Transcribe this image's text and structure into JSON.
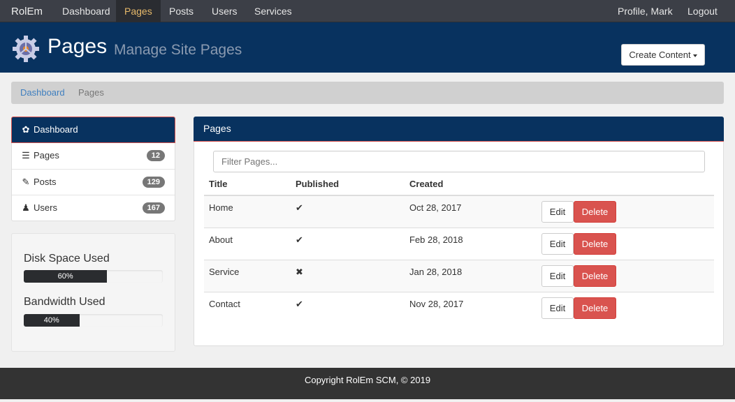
{
  "navbar": {
    "brand": "RolEm",
    "items": [
      {
        "label": "Dashboard",
        "active": false
      },
      {
        "label": "Pages",
        "active": true
      },
      {
        "label": "Posts",
        "active": false
      },
      {
        "label": "Users",
        "active": false
      },
      {
        "label": "Services",
        "active": false
      }
    ],
    "right": {
      "profile": "Profile, Mark",
      "logout": "Logout"
    }
  },
  "header": {
    "logo_icon": "gear-icon",
    "title": "Pages",
    "subtitle": "Manage Site Pages",
    "create_button": "Create Content"
  },
  "breadcrumb": {
    "link": "Dashboard",
    "current": "Pages"
  },
  "sidebar": {
    "items": [
      {
        "label": "Dashboard",
        "icon": "cog-icon",
        "active": true
      },
      {
        "label": "Pages",
        "icon": "list-icon",
        "count": "12"
      },
      {
        "label": "Posts",
        "icon": "pencil-icon",
        "count": "129"
      },
      {
        "label": "Users",
        "icon": "user-icon",
        "count": "167"
      }
    ]
  },
  "usage": {
    "disk": {
      "label": "Disk Space Used",
      "percent": 60,
      "text": "60%"
    },
    "bandwidth": {
      "label": "Bandwidth Used",
      "percent": 40,
      "text": "40%"
    }
  },
  "main": {
    "panel_title": "Pages",
    "filter_placeholder": "Filter Pages...",
    "columns": [
      "Title",
      "Published",
      "Created"
    ],
    "rows": [
      {
        "title": "Home",
        "published": "✔",
        "created": "Oct 28, 2017"
      },
      {
        "title": "About",
        "published": "✔",
        "created": "Feb 28, 2018"
      },
      {
        "title": "Service",
        "published": "✖",
        "created": "Jan 28, 2018"
      },
      {
        "title": "Contact",
        "published": "✔",
        "created": "Nov 28, 2017"
      }
    ],
    "edit_label": "Edit",
    "delete_label": "Delete"
  },
  "footer": {
    "text": "Copyright RolEm SCM, © 2019"
  },
  "colors": {
    "navy": "#08325f",
    "danger": "#d9534f",
    "active_nav": "#e7b96a"
  }
}
